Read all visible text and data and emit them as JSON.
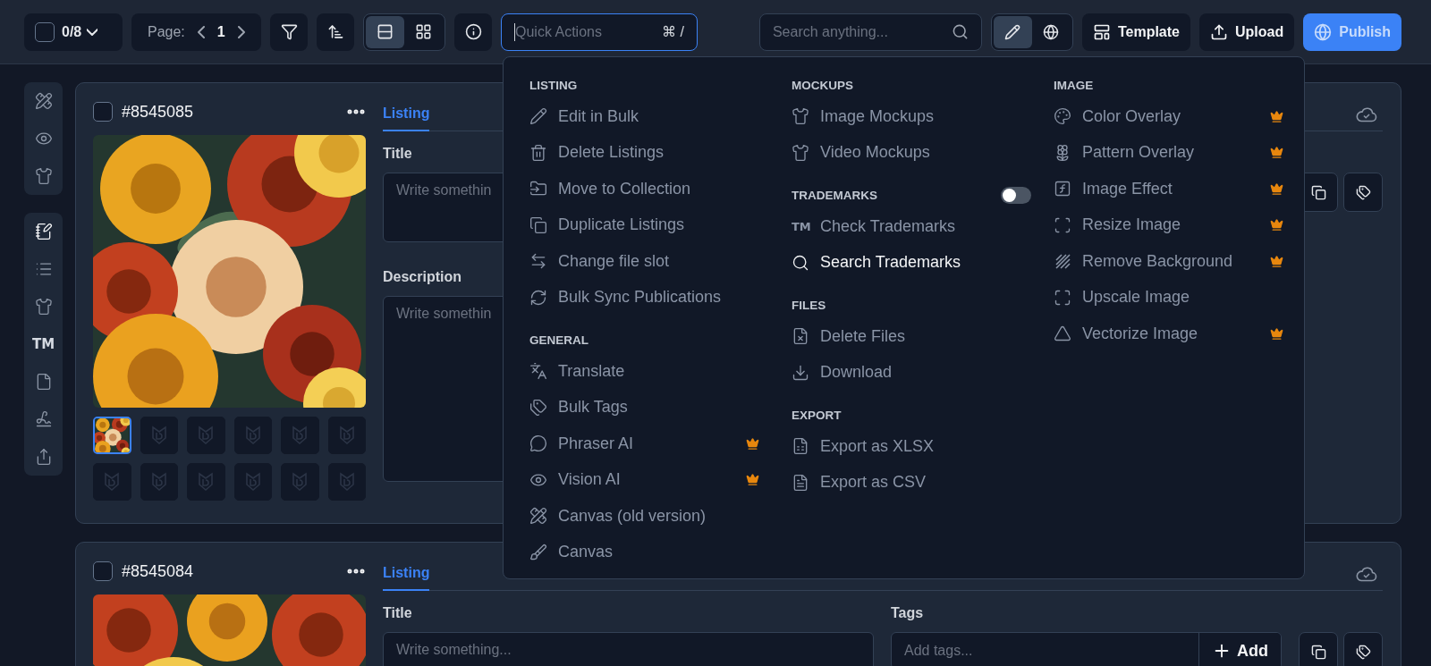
{
  "toolbar": {
    "selection": {
      "checked": false,
      "count": "0/8"
    },
    "page": {
      "label": "Page:",
      "value": "1"
    },
    "view_modes": [
      {
        "selected": true
      },
      {
        "selected": false
      }
    ],
    "quick_actions": {
      "placeholder": "Quick Actions",
      "shortcut": "⌘ /"
    },
    "search": {
      "placeholder": "Search anything..."
    },
    "modes": [
      {
        "selected": true
      },
      {
        "selected": false
      }
    ],
    "buttons": [
      {
        "label": "Template",
        "kind": "dark"
      },
      {
        "label": "Upload",
        "kind": "dark"
      },
      {
        "label": "Publish",
        "kind": "primary"
      }
    ]
  },
  "rail": [
    [
      {
        "selected": false
      },
      {
        "selected": false
      },
      {
        "selected": false
      }
    ],
    [
      {
        "selected": true
      },
      {
        "selected": false
      },
      {
        "selected": false
      },
      {
        "selected": false,
        "glyph": "TM"
      },
      {
        "selected": false
      },
      {
        "selected": false
      },
      {
        "selected": false
      }
    ]
  ],
  "listings": [
    {
      "id": "#8545085",
      "checked": false,
      "tab": "Listing",
      "title_label": "Title",
      "title_placeholder": "Write somethin",
      "description_label": "Description",
      "description_placeholder": "Write somethin",
      "thumbnails": [
        {
          "kind": "picture",
          "selected": true
        },
        {
          "kind": "empty",
          "selected": false
        },
        {
          "kind": "empty",
          "selected": false
        },
        {
          "kind": "empty",
          "selected": false
        },
        {
          "kind": "empty",
          "selected": false
        },
        {
          "kind": "empty",
          "selected": false
        },
        {
          "kind": "empty",
          "selected": false
        },
        {
          "kind": "empty",
          "selected": false
        },
        {
          "kind": "empty",
          "selected": false
        },
        {
          "kind": "empty",
          "selected": false
        },
        {
          "kind": "empty",
          "selected": false
        },
        {
          "kind": "empty",
          "selected": false
        }
      ]
    },
    {
      "id": "#8545084",
      "checked": false,
      "tab": "Listing",
      "title_label": "Title",
      "title_placeholder": "Write something...",
      "tags_label": "Tags",
      "tags_placeholder": "Add tags...",
      "add_button": "Add"
    }
  ],
  "quick_menu": {
    "columns": [
      {
        "sections": [
          {
            "heading": "LISTING",
            "items": [
              {
                "label": "Edit in Bulk",
                "premium": false,
                "selected": false
              },
              {
                "label": "Delete Listings",
                "premium": false,
                "selected": false
              },
              {
                "label": "Move to Collection",
                "premium": false,
                "selected": false
              },
              {
                "label": "Duplicate Listings",
                "premium": false,
                "selected": false
              },
              {
                "label": "Change file slot",
                "premium": false,
                "selected": false
              },
              {
                "label": "Bulk Sync Publications",
                "premium": false,
                "selected": false
              }
            ]
          },
          {
            "heading": "GENERAL",
            "items": [
              {
                "label": "Translate",
                "premium": false,
                "selected": false
              },
              {
                "label": "Bulk Tags",
                "premium": false,
                "selected": false
              },
              {
                "label": "Phraser AI",
                "premium": true,
                "selected": false
              },
              {
                "label": "Vision AI",
                "premium": true,
                "selected": false
              },
              {
                "label": "Canvas (old version)",
                "premium": false,
                "selected": false
              },
              {
                "label": "Canvas",
                "premium": false,
                "selected": false
              }
            ]
          }
        ]
      },
      {
        "sections": [
          {
            "heading": "MOCKUPS",
            "items": [
              {
                "label": "Image Mockups",
                "premium": false,
                "selected": false
              },
              {
                "label": "Video Mockups",
                "premium": false,
                "selected": false
              }
            ]
          },
          {
            "heading": "TRADEMARKS",
            "toggle": {
              "on": false
            },
            "items": [
              {
                "label": "Check Trademarks",
                "premium": false,
                "selected": false,
                "glyph": "TM"
              },
              {
                "label": "Search Trademarks",
                "premium": false,
                "selected": true
              }
            ]
          },
          {
            "heading": "FILES",
            "items": [
              {
                "label": "Delete Files",
                "premium": false,
                "selected": false
              },
              {
                "label": "Download",
                "premium": false,
                "selected": false
              }
            ]
          },
          {
            "heading": "EXPORT",
            "items": [
              {
                "label": "Export as XLSX",
                "premium": false,
                "selected": false
              },
              {
                "label": "Export as CSV",
                "premium": false,
                "selected": false
              }
            ]
          }
        ]
      },
      {
        "sections": [
          {
            "heading": "IMAGE",
            "items": [
              {
                "label": "Color Overlay",
                "premium": true,
                "selected": false
              },
              {
                "label": "Pattern Overlay",
                "premium": true,
                "selected": false
              },
              {
                "label": "Image Effect",
                "premium": true,
                "selected": false
              },
              {
                "label": "Resize Image",
                "premium": true,
                "selected": false
              },
              {
                "label": "Remove Background",
                "premium": true,
                "selected": false
              },
              {
                "label": "Upscale Image",
                "premium": false,
                "selected": false
              },
              {
                "label": "Vectorize Image",
                "premium": true,
                "selected": false
              }
            ]
          }
        ]
      }
    ]
  }
}
